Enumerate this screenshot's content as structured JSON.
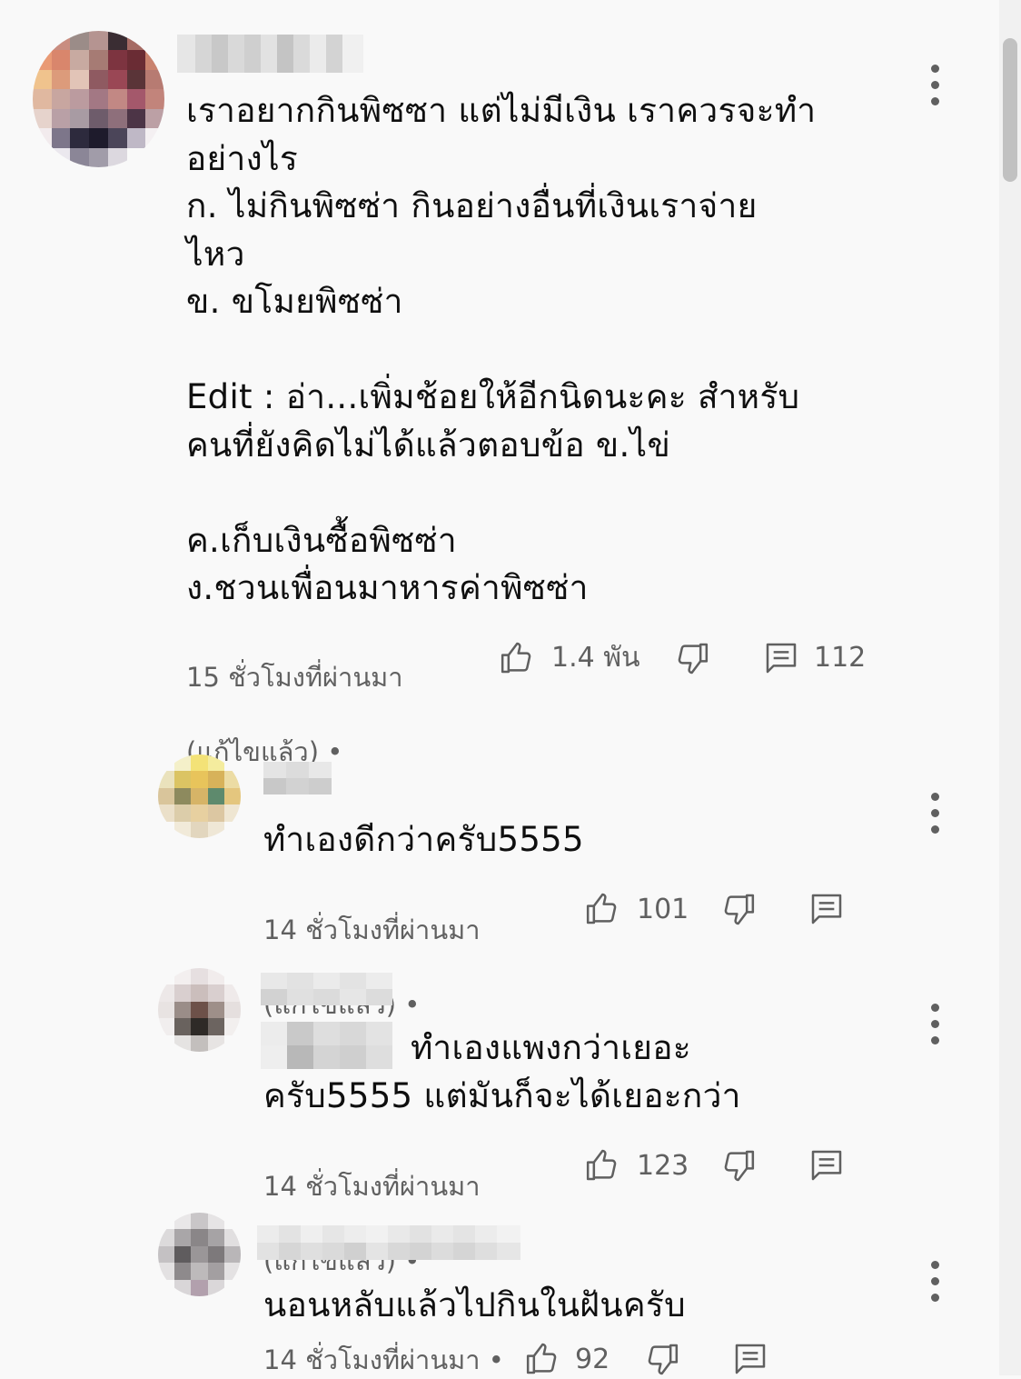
{
  "comments": [
    {
      "body": "เราอยากกินพิซซา แต่ไม่มีเงิน เราควรจะทำ\nอย่างไร\nก. ไม่กินพิซซ่า กินอย่างอื่นที่เงินเราจ่าย\nไหว\nข. ขโมยพิซซ่า\n\nEdit : อ่า...เพิ่มช้อยให้อีกนิดนะคะ สำหรับ\nคนที่ยังคิดไม่ได้แล้วตอบข้อ ข.ไข่\n\nค.เก็บเงินซื้อพิซซ่า\nง.ชวนเพื่อนมาหารค่าพิซซ่า",
      "time": "15 ชั่วโมงที่ผ่านมา",
      "edited": "(แก้ไขแล้ว) •",
      "likes": "1.4 พัน",
      "replies": "112"
    },
    {
      "body": "ทำเองดีกว่าครับ5555",
      "time": "14 ชั่วโมงที่ผ่านมา",
      "edited": "(แก้ไขแล้ว) •",
      "likes": "101"
    },
    {
      "body_line1": "ทำเองแพงกว่าเยอะ",
      "body_line2": "ครับ5555 แต่มันก็จะได้เยอะกว่า",
      "time": "14 ชั่วโมงที่ผ่านมา",
      "edited": "(แก้ไขแล้ว) •",
      "likes": "123"
    },
    {
      "body": "นอนหลับแล้วไปกินในฝันครับ",
      "time": "14 ชั่วโมงที่ผ่านมา •",
      "likes": "92"
    }
  ],
  "icons": {
    "like": "thumb-up-icon",
    "dislike": "thumb-down-icon",
    "reply": "comment-icon",
    "menu": "more-vert-icon"
  },
  "colors": {
    "background": "#f9f9f9",
    "text": "#0f0f0f",
    "secondary_text": "#606060"
  }
}
